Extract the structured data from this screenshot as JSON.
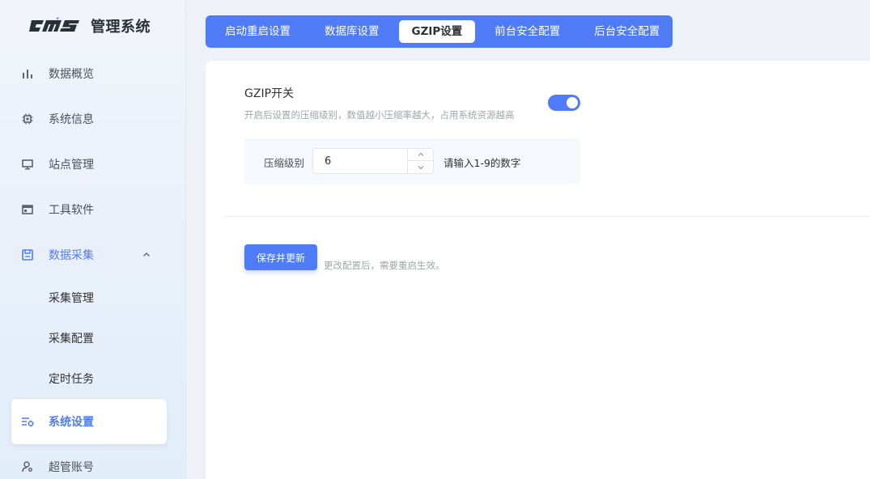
{
  "brand": {
    "title": "管理系统"
  },
  "sidebar": {
    "items": [
      {
        "label": "数据概览",
        "icon": "bar-chart-icon"
      },
      {
        "label": "系统信息",
        "icon": "chip-icon"
      },
      {
        "label": "站点管理",
        "icon": "monitor-icon"
      },
      {
        "label": "工具软件",
        "icon": "window-icon"
      },
      {
        "label": "数据采集",
        "icon": "save-icon",
        "expanded": true
      },
      {
        "label": "采集管理"
      },
      {
        "label": "采集配置"
      },
      {
        "label": "定时任务"
      },
      {
        "label": "系统设置",
        "icon": "settings-list-icon",
        "active": true
      },
      {
        "label": "超管账号",
        "icon": "user-settings-icon"
      }
    ]
  },
  "tabs": [
    {
      "label": "启动重启设置"
    },
    {
      "label": "数据库设置"
    },
    {
      "label": "GZIP设置",
      "active": true
    },
    {
      "label": "前台安全配置"
    },
    {
      "label": "后台安全配置"
    }
  ],
  "gzip": {
    "title": "GZIP开关",
    "description": "开启后设置的压缩级别，数值越小压缩率越大，占用系统资源越高",
    "enabled": true,
    "level_label": "压缩级别",
    "level_value": "6",
    "level_hint": "请输入1-9的数字"
  },
  "actions": {
    "save_label": "保存并更新",
    "note": "更改配置后，需要重启生效。"
  },
  "colors": {
    "accent": "#4f7cf6",
    "sidebar_bg": "#eef2f8"
  }
}
